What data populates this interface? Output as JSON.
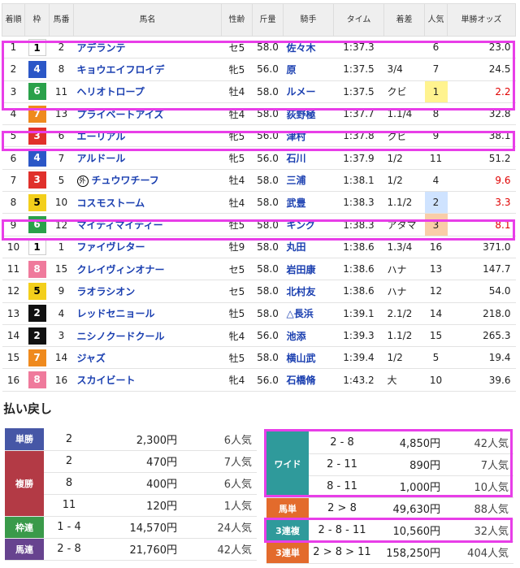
{
  "table": {
    "headers": {
      "rank": "着順",
      "waku": "枠",
      "umaban": "馬番",
      "horse": "馬名",
      "sexage": "性齢",
      "weight": "斤量",
      "jockey": "騎手",
      "time": "タイム",
      "margin": "着差",
      "popularity": "人気",
      "odds": "単勝オッズ"
    },
    "rows": [
      {
        "rank": "1",
        "waku": "1",
        "umaban": "2",
        "horse": "アデランテ",
        "sexage": "セ5",
        "weight": "58.0",
        "jockey": "佐々木",
        "time": "1:37.3",
        "margin": "",
        "pop": "6",
        "odds": "23.0"
      },
      {
        "rank": "2",
        "waku": "4",
        "umaban": "8",
        "horse": "キョウエイフロイデ",
        "sexage": "牝5",
        "weight": "56.0",
        "jockey": "原",
        "time": "1:37.5",
        "margin": "3/4",
        "pop": "7",
        "odds": "24.5"
      },
      {
        "rank": "3",
        "waku": "6",
        "umaban": "11",
        "horse": "ヘリオトロープ",
        "sexage": "牡4",
        "weight": "58.0",
        "jockey": "ルメー",
        "time": "1:37.5",
        "margin": "クビ",
        "pop": "1",
        "odds": "2.2"
      },
      {
        "rank": "4",
        "waku": "7",
        "umaban": "13",
        "horse": "プライベートアイズ",
        "sexage": "牡4",
        "weight": "58.0",
        "jockey": "荻野極",
        "time": "1:37.7",
        "margin": "1.1/4",
        "pop": "8",
        "odds": "32.8"
      },
      {
        "rank": "5",
        "waku": "3",
        "umaban": "6",
        "horse": "エーリアル",
        "sexage": "牝5",
        "weight": "56.0",
        "jockey": "津村",
        "time": "1:37.8",
        "margin": "クビ",
        "pop": "9",
        "odds": "38.1"
      },
      {
        "rank": "6",
        "waku": "4",
        "umaban": "7",
        "horse": "アルドール",
        "sexage": "牝5",
        "weight": "56.0",
        "jockey": "石川",
        "time": "1:37.9",
        "margin": "1/2",
        "pop": "11",
        "odds": "51.2"
      },
      {
        "rank": "7",
        "waku": "3",
        "umaban": "5",
        "horse": "チュウワチーフ",
        "mark": "外",
        "sexage": "牡4",
        "weight": "58.0",
        "jockey": "三浦",
        "time": "1:38.1",
        "margin": "1/2",
        "pop": "4",
        "odds": "9.6"
      },
      {
        "rank": "8",
        "waku": "5",
        "umaban": "10",
        "horse": "コスモストーム",
        "sexage": "牡4",
        "weight": "58.0",
        "jockey": "武豊",
        "time": "1:38.3",
        "margin": "1.1/2",
        "pop": "2",
        "odds": "3.3"
      },
      {
        "rank": "9",
        "waku": "6",
        "umaban": "12",
        "horse": "マイティマイティー",
        "sexage": "牡5",
        "weight": "58.0",
        "jockey": "キング",
        "time": "1:38.3",
        "margin": "アタマ",
        "pop": "3",
        "odds": "8.1"
      },
      {
        "rank": "10",
        "waku": "1",
        "umaban": "1",
        "horse": "ファイヴレター",
        "sexage": "牡9",
        "weight": "58.0",
        "jockey": "丸田",
        "time": "1:38.6",
        "margin": "1.3/4",
        "pop": "16",
        "odds": "371.0"
      },
      {
        "rank": "11",
        "waku": "8",
        "umaban": "15",
        "horse": "クレイヴィンオナー",
        "sexage": "セ5",
        "weight": "58.0",
        "jockey": "岩田康",
        "time": "1:38.6",
        "margin": "ハナ",
        "pop": "13",
        "odds": "147.7"
      },
      {
        "rank": "12",
        "waku": "5",
        "umaban": "9",
        "horse": "ラオラシオン",
        "sexage": "セ5",
        "weight": "58.0",
        "jockey": "北村友",
        "time": "1:38.6",
        "margin": "ハナ",
        "pop": "12",
        "odds": "54.0"
      },
      {
        "rank": "13",
        "waku": "2",
        "umaban": "4",
        "horse": "レッドセニョール",
        "sexage": "牡5",
        "weight": "58.0",
        "jockey": "△長浜",
        "time": "1:39.1",
        "margin": "2.1/2",
        "pop": "14",
        "odds": "218.0"
      },
      {
        "rank": "14",
        "waku": "2",
        "umaban": "3",
        "horse": "ニシノクードクール",
        "sexage": "牝4",
        "weight": "56.0",
        "jockey": "池添",
        "time": "1:39.3",
        "margin": "1.1/2",
        "pop": "15",
        "odds": "265.3"
      },
      {
        "rank": "15",
        "waku": "7",
        "umaban": "14",
        "horse": "ジャズ",
        "sexage": "牡5",
        "weight": "58.0",
        "jockey": "横山武",
        "time": "1:39.4",
        "margin": "1/2",
        "pop": "5",
        "odds": "19.4"
      },
      {
        "rank": "16",
        "waku": "8",
        "umaban": "16",
        "horse": "スカイビート",
        "sexage": "牝4",
        "weight": "56.0",
        "jockey": "石橋脩",
        "time": "1:43.2",
        "margin": "大",
        "pop": "10",
        "odds": "39.6"
      }
    ]
  },
  "payout": {
    "heading": "払い戻し",
    "tansho": {
      "label": "単勝",
      "rows": [
        {
          "combo": "2",
          "amount": "2,300円",
          "pop": "6人気"
        }
      ]
    },
    "fukusho": {
      "label": "複勝",
      "rows": [
        {
          "combo": "2",
          "amount": "470円",
          "pop": "7人気"
        },
        {
          "combo": "8",
          "amount": "400円",
          "pop": "6人気"
        },
        {
          "combo": "11",
          "amount": "120円",
          "pop": "1人気"
        }
      ]
    },
    "wakuren": {
      "label": "枠連",
      "rows": [
        {
          "combo": "1 - 4",
          "amount": "14,570円",
          "pop": "24人気"
        }
      ]
    },
    "umaren": {
      "label": "馬連",
      "rows": [
        {
          "combo": "2 - 8",
          "amount": "21,760円",
          "pop": "42人気"
        }
      ]
    },
    "wide": {
      "label": "ワイド",
      "rows": [
        {
          "combo": "2 - 8",
          "amount": "4,850円",
          "pop": "42人気"
        },
        {
          "combo": "2 - 11",
          "amount": "890円",
          "pop": "7人気"
        },
        {
          "combo": "8 - 11",
          "amount": "1,000円",
          "pop": "10人気"
        }
      ]
    },
    "umatan": {
      "label": "馬単",
      "rows": [
        {
          "combo": "2 > 8",
          "amount": "49,630円",
          "pop": "88人気"
        }
      ]
    },
    "sanrenpuku": {
      "label": "3連複",
      "rows": [
        {
          "combo": "2 - 8 - 11",
          "amount": "10,560円",
          "pop": "32人気"
        }
      ]
    },
    "sanrentan": {
      "label": "3連単",
      "rows": [
        {
          "combo": "2 > 8 > 11",
          "amount": "158,250円",
          "pop": "404人気"
        }
      ]
    }
  },
  "colors": {
    "highlight": "#e83ee8",
    "odds_red": "#e00000",
    "link_blue": "#1a3fb0"
  }
}
